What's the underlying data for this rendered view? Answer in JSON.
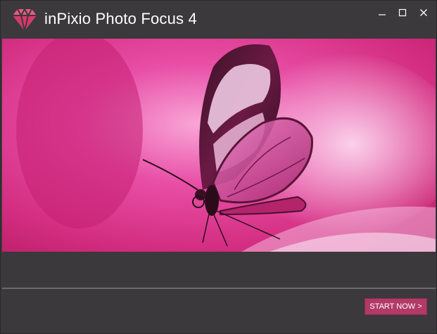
{
  "window": {
    "title": "inPixio Photo Focus 4"
  },
  "footer": {
    "start_label": "START NOW >"
  },
  "colors": {
    "titlebar": "#3b393b",
    "accent": "#b23a66",
    "hero_pink": "#d0307f"
  },
  "icons": {
    "logo": "diamond-logo-icon",
    "minimize": "minimize-icon",
    "maximize": "maximize-icon",
    "close": "close-icon"
  }
}
